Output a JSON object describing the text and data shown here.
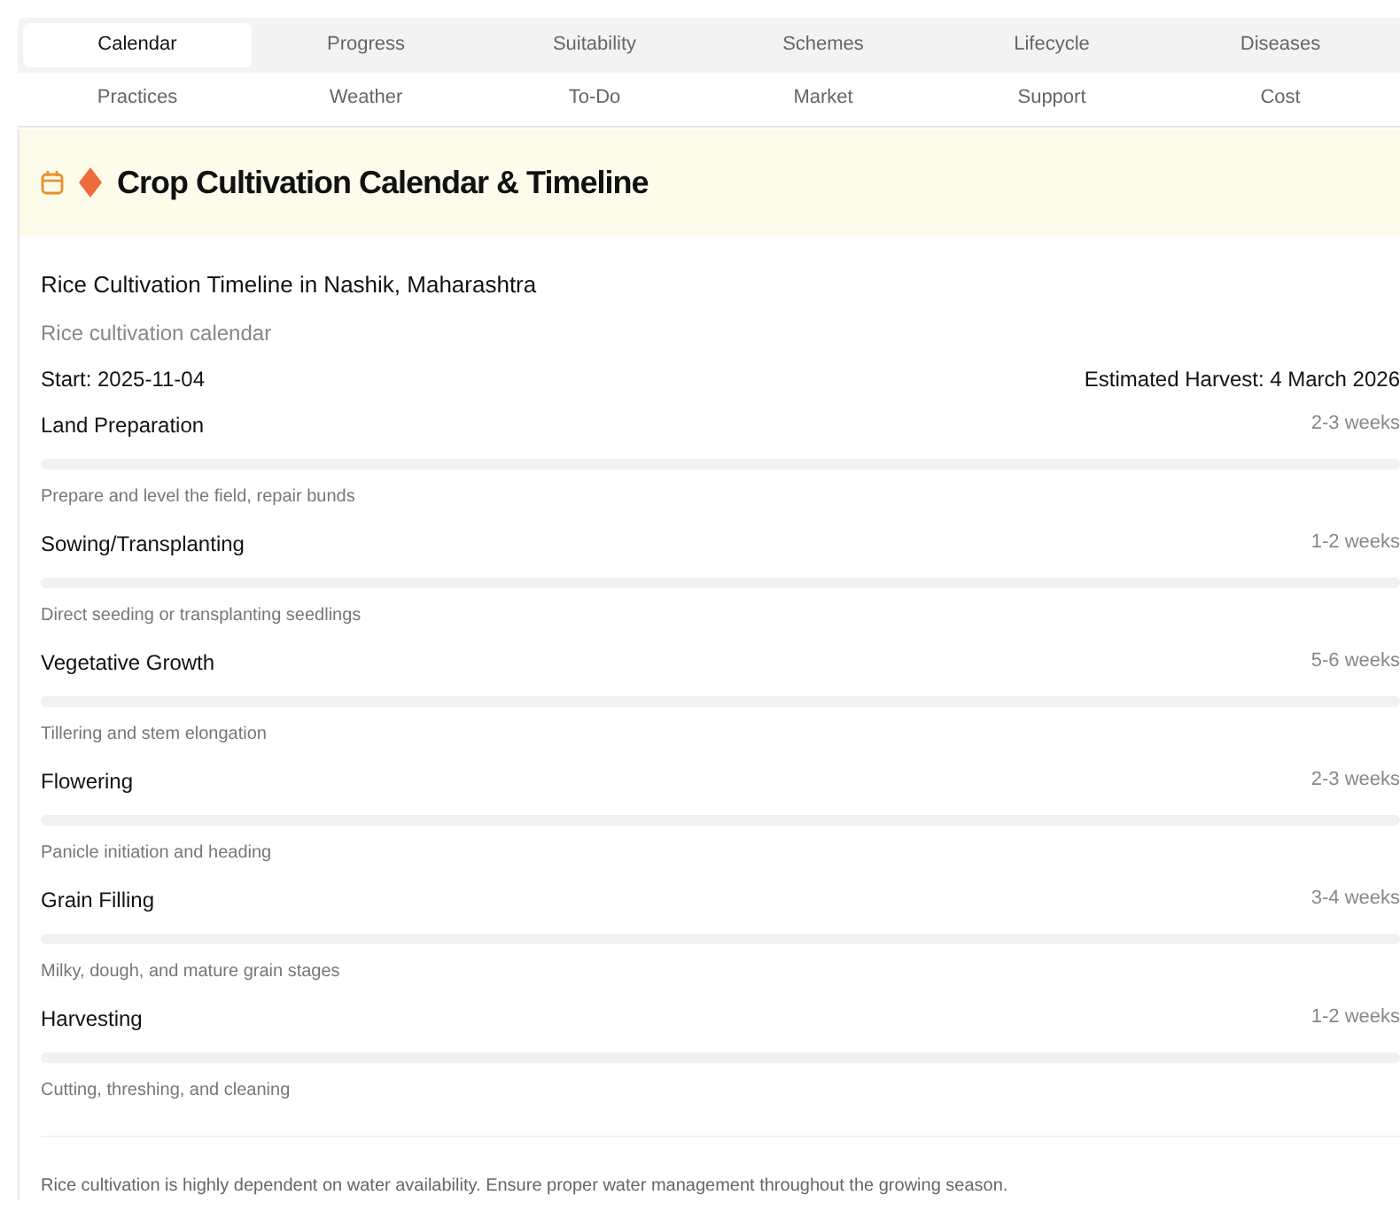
{
  "tabs": [
    {
      "label": "Calendar",
      "selected": true
    },
    {
      "label": "Progress",
      "selected": false
    },
    {
      "label": "Suitability",
      "selected": false
    },
    {
      "label": "Schemes",
      "selected": false
    },
    {
      "label": "Lifecycle",
      "selected": false
    },
    {
      "label": "Diseases",
      "selected": false
    },
    {
      "label": "Practices",
      "selected": false
    },
    {
      "label": "Weather",
      "selected": false
    },
    {
      "label": "To-Do",
      "selected": false
    },
    {
      "label": "Market",
      "selected": false
    },
    {
      "label": "Support",
      "selected": false
    },
    {
      "label": "Cost",
      "selected": false
    }
  ],
  "card": {
    "title": "Crop Cultivation Calendar & Timeline"
  },
  "timeline": {
    "title": "Rice Cultivation Timeline in Nashik, Maharashtra",
    "subtitle": "Rice cultivation calendar",
    "start": "Start: 2025-11-04",
    "harvest": "Estimated Harvest: 4 March 2026",
    "stages": [
      {
        "name": "Land Preparation",
        "duration": "2-3 weeks",
        "level": 0,
        "description": "Prepare and level the field, repair bunds"
      },
      {
        "name": "Sowing/Transplanting",
        "duration": "1-2 weeks",
        "level": 0,
        "description": "Direct seeding or transplanting seedlings"
      },
      {
        "name": "Vegetative Growth",
        "duration": "5-6 weeks",
        "level": 0,
        "description": "Tillering and stem elongation"
      },
      {
        "name": "Flowering",
        "duration": "2-3 weeks",
        "level": 0,
        "description": "Panicle initiation and heading"
      },
      {
        "name": "Grain Filling",
        "duration": "3-4 weeks",
        "level": 0,
        "description": "Milky, dough, and mature grain stages"
      },
      {
        "name": "Harvesting",
        "duration": "1-2 weeks",
        "level": 0,
        "description": "Cutting, threshing, and cleaning"
      }
    ],
    "note": "Rice cultivation is highly dependent on water availability. Ensure proper water management throughout the growing season."
  }
}
